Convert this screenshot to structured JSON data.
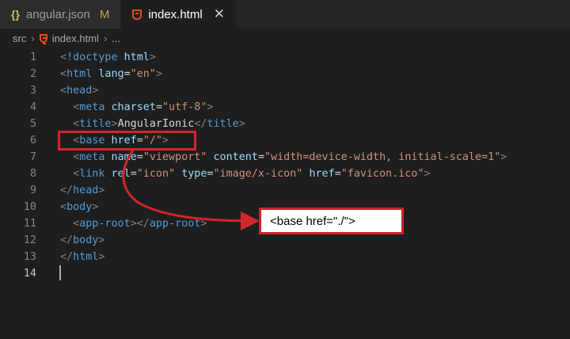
{
  "tabs": [
    {
      "label": "angular.json",
      "badge": "M",
      "icon": "json-icon"
    },
    {
      "label": "index.html",
      "close": "✕",
      "icon": "html-icon",
      "active": true
    }
  ],
  "breadcrumb": {
    "folder": "src",
    "sep1": "›",
    "file": "index.html",
    "sep2": "›",
    "more": "..."
  },
  "lines": [
    {
      "num": "1",
      "parts": [
        [
          "punc",
          "<"
        ],
        [
          "tag",
          "!doctype"
        ],
        [
          "txt",
          " "
        ],
        [
          "attr",
          "html"
        ],
        [
          "punc",
          ">"
        ]
      ]
    },
    {
      "num": "2",
      "parts": [
        [
          "punc",
          "<"
        ],
        [
          "tag",
          "html"
        ],
        [
          "txt",
          " "
        ],
        [
          "attr",
          "lang"
        ],
        [
          "txt",
          "="
        ],
        [
          "str",
          "\"en\""
        ],
        [
          "punc",
          ">"
        ]
      ]
    },
    {
      "num": "3",
      "parts": [
        [
          "punc",
          "<"
        ],
        [
          "tag",
          "head"
        ],
        [
          "punc",
          ">"
        ]
      ]
    },
    {
      "num": "4",
      "parts": [
        [
          "txt",
          "  "
        ],
        [
          "punc",
          "<"
        ],
        [
          "tag",
          "meta"
        ],
        [
          "txt",
          " "
        ],
        [
          "attr",
          "charset"
        ],
        [
          "txt",
          "="
        ],
        [
          "str",
          "\"utf-8\""
        ],
        [
          "punc",
          ">"
        ]
      ]
    },
    {
      "num": "5",
      "parts": [
        [
          "txt",
          "  "
        ],
        [
          "punc",
          "<"
        ],
        [
          "tag",
          "title"
        ],
        [
          "punc",
          ">"
        ],
        [
          "txt",
          "AngularIonic"
        ],
        [
          "punc",
          "</"
        ],
        [
          "tag",
          "title"
        ],
        [
          "punc",
          ">"
        ]
      ]
    },
    {
      "num": "6",
      "parts": [
        [
          "txt",
          "  "
        ],
        [
          "punc",
          "<"
        ],
        [
          "tag",
          "base"
        ],
        [
          "txt",
          " "
        ],
        [
          "attr",
          "href"
        ],
        [
          "txt",
          "="
        ],
        [
          "str",
          "\"/\""
        ],
        [
          "punc",
          ">"
        ]
      ]
    },
    {
      "num": "7",
      "parts": [
        [
          "txt",
          "  "
        ],
        [
          "punc",
          "<"
        ],
        [
          "tag",
          "meta"
        ],
        [
          "txt",
          " "
        ],
        [
          "attr",
          "name"
        ],
        [
          "txt",
          "="
        ],
        [
          "str",
          "\"viewport\""
        ],
        [
          "txt",
          " "
        ],
        [
          "attr",
          "content"
        ],
        [
          "txt",
          "="
        ],
        [
          "str",
          "\"width=device-width, initial-scale=1\""
        ],
        [
          "punc",
          ">"
        ]
      ]
    },
    {
      "num": "8",
      "parts": [
        [
          "txt",
          "  "
        ],
        [
          "punc",
          "<"
        ],
        [
          "tag",
          "link"
        ],
        [
          "txt",
          " "
        ],
        [
          "attr",
          "rel"
        ],
        [
          "txt",
          "="
        ],
        [
          "str",
          "\"icon\""
        ],
        [
          "txt",
          " "
        ],
        [
          "attr",
          "type"
        ],
        [
          "txt",
          "="
        ],
        [
          "str",
          "\"image/x-icon\""
        ],
        [
          "txt",
          " "
        ],
        [
          "attr",
          "href"
        ],
        [
          "txt",
          "="
        ],
        [
          "str",
          "\"favicon.ico\""
        ],
        [
          "punc",
          ">"
        ]
      ]
    },
    {
      "num": "9",
      "parts": [
        [
          "punc",
          "</"
        ],
        [
          "tag",
          "head"
        ],
        [
          "punc",
          ">"
        ]
      ]
    },
    {
      "num": "10",
      "parts": [
        [
          "punc",
          "<"
        ],
        [
          "tag",
          "body"
        ],
        [
          "punc",
          ">"
        ]
      ]
    },
    {
      "num": "11",
      "parts": [
        [
          "txt",
          "  "
        ],
        [
          "punc",
          "<"
        ],
        [
          "tag",
          "app-root"
        ],
        [
          "punc",
          "></"
        ],
        [
          "tag",
          "app-root"
        ],
        [
          "punc",
          ">"
        ]
      ]
    },
    {
      "num": "12",
      "parts": [
        [
          "punc",
          "</"
        ],
        [
          "tag",
          "body"
        ],
        [
          "punc",
          ">"
        ]
      ]
    },
    {
      "num": "13",
      "parts": [
        [
          "punc",
          "</"
        ],
        [
          "tag",
          "html"
        ],
        [
          "punc",
          ">"
        ]
      ]
    },
    {
      "num": "14",
      "parts": [],
      "current": true
    }
  ],
  "annotation": {
    "callout_text": "<base href=\"./\">",
    "highlight_color": "#d3262b"
  }
}
